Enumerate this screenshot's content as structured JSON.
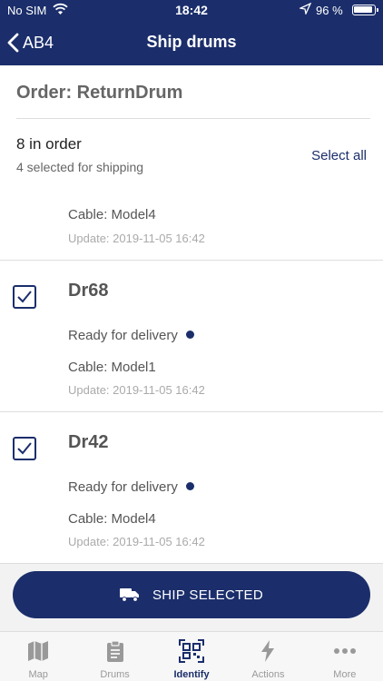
{
  "status_bar": {
    "carrier": "No SIM",
    "time": "18:42",
    "battery": "96 %"
  },
  "nav": {
    "back_label": "AB4",
    "title": "Ship drums"
  },
  "order": {
    "title": "Order: ReturnDrum",
    "count": "8 in order",
    "selected": "4 selected for shipping",
    "select_all": "Select all"
  },
  "partial_item": {
    "cable": "Cable: Model4",
    "update": "Update: 2019-11-05 16:42"
  },
  "items": [
    {
      "name": "Dr68",
      "status": "Ready for delivery",
      "cable": "Cable: Model1",
      "update": "Update: 2019-11-05 16:42",
      "checked": true
    },
    {
      "name": "Dr42",
      "status": "Ready for delivery",
      "cable": "Cable: Model4",
      "update": "Update: 2019-11-05 16:42",
      "checked": true
    }
  ],
  "ship_button": {
    "label": "SHIP SELECTED"
  },
  "tabs": [
    {
      "label": "Map",
      "icon": "map-icon"
    },
    {
      "label": "Drums",
      "icon": "clipboard-icon"
    },
    {
      "label": "Identify",
      "icon": "qr-code-icon",
      "active": true
    },
    {
      "label": "Actions",
      "icon": "lightning-icon"
    },
    {
      "label": "More",
      "icon": "more-icon"
    }
  ],
  "colors": {
    "brand": "#1b2e6b",
    "muted": "#999999"
  }
}
